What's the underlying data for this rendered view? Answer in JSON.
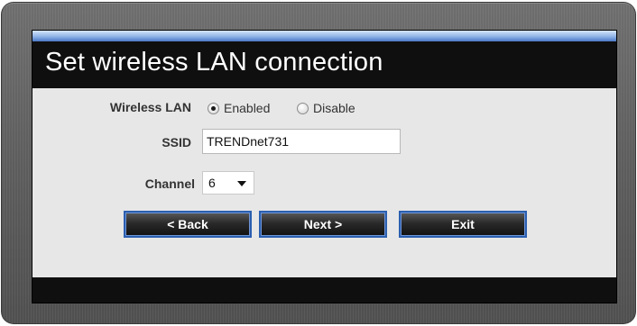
{
  "dialog": {
    "title": "Set wireless LAN connection"
  },
  "form": {
    "wireless_lan": {
      "label": "Wireless LAN",
      "options": [
        {
          "label": "Enabled",
          "selected": true
        },
        {
          "label": "Disable",
          "selected": false
        }
      ]
    },
    "ssid": {
      "label": "SSID",
      "value": "TRENDnet731"
    },
    "channel": {
      "label": "Channel",
      "selected": "6"
    }
  },
  "buttons": {
    "back_label": "< Back",
    "next_label": "Next >",
    "exit_label": "Exit"
  },
  "colors": {
    "button_border": "#2b5fb0",
    "content_bg": "#e7e7e7",
    "title_bar_bg": "#0f0f0f"
  }
}
